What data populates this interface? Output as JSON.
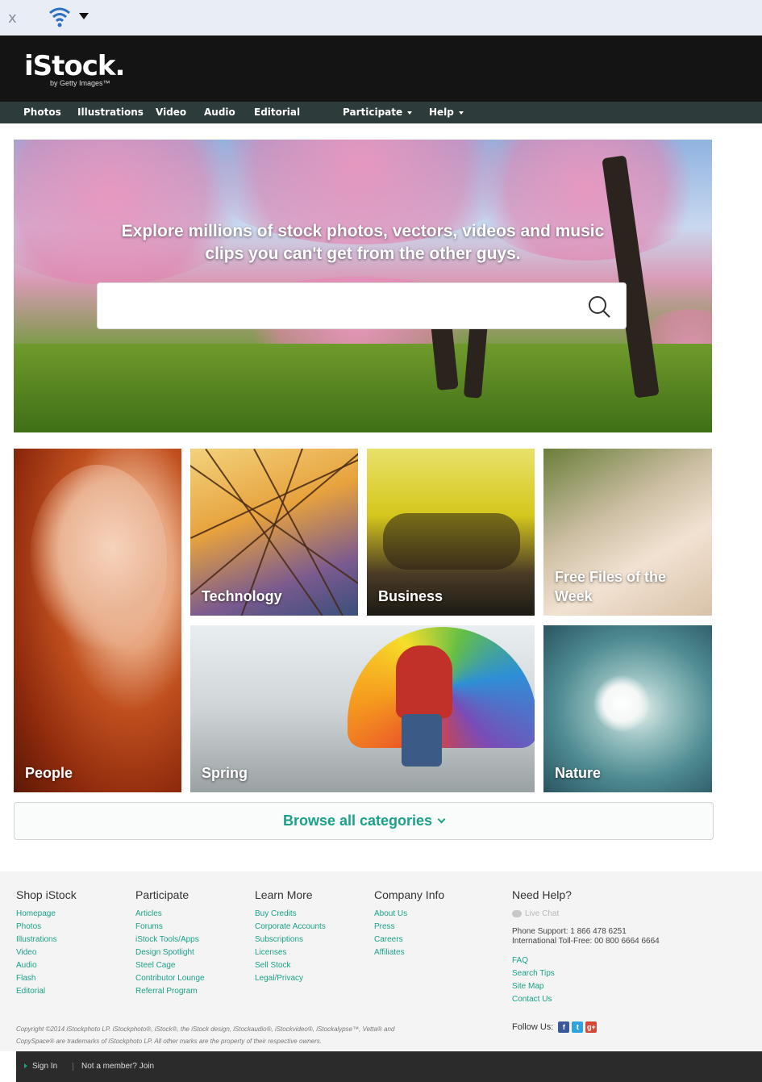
{
  "browser": {
    "close_glyph": "x",
    "logo_icon": "wifi-logo-icon"
  },
  "header": {
    "brand": "iStock.",
    "brand_sub": "by Getty Images™"
  },
  "nav": {
    "items": [
      {
        "label": "Photos"
      },
      {
        "label": "Illustrations"
      },
      {
        "label": "Video"
      },
      {
        "label": "Audio"
      },
      {
        "label": "Editorial"
      },
      {
        "label": "Participate"
      },
      {
        "label": "Help"
      }
    ]
  },
  "hero": {
    "headline": "Explore millions of stock photos, vectors, videos and music clips you can't get from the other guys.",
    "search_value": "",
    "search_placeholder": ""
  },
  "tiles": [
    {
      "label": "People"
    },
    {
      "label": "Technology"
    },
    {
      "label": "Business"
    },
    {
      "label": "Free Files of the Week"
    },
    {
      "label": "Spring"
    },
    {
      "label": "Nature"
    }
  ],
  "browse": {
    "label": "Browse all categories"
  },
  "footer": {
    "shop": {
      "title": "Shop iStock",
      "links": [
        "Homepage",
        "Photos",
        "Illustrations",
        "Video",
        "Audio",
        "Flash",
        "Editorial"
      ]
    },
    "participate": {
      "title": "Participate",
      "links": [
        "Articles",
        "Forums",
        "iStock Tools/Apps",
        "Design Spotlight",
        "Steel Cage",
        "Contributor Lounge",
        "Referral Program"
      ]
    },
    "learn": {
      "title": "Learn More",
      "links": [
        "Buy Credits",
        "Corporate Accounts",
        "Subscriptions",
        "Licenses",
        "Sell Stock",
        "Legal/Privacy"
      ]
    },
    "company": {
      "title": "Company Info",
      "links": [
        "About Us",
        "Press",
        "Careers",
        "Affiliates"
      ]
    },
    "help": {
      "title": "Need Help?",
      "live_chat": "Live Chat",
      "phone": "Phone Support: 1 866 478 6251",
      "intl": "International Toll-Free: 00 800 6664 6664",
      "links": [
        "FAQ",
        "Search Tips",
        "Site Map",
        "Contact Us"
      ]
    },
    "copyright_line1": "Copyright ©2014 iStockphoto LP. iStockphoto®, iStock®, the iStock design, iStockaudio®, iStockvideo®, iStockalypse™, Vetta® and",
    "copyright_line2": "CopySpace® are trademarks of iStockphoto LP. All other marks are the property of their respective owners.",
    "follow_label": "Follow Us:"
  },
  "bottom_bar": {
    "sign_in": "Sign In",
    "join": "Not a member? Join"
  },
  "colors": {
    "accent": "#1aa187",
    "header_bg": "#141414",
    "nav_bg": "#2d3b3b"
  }
}
